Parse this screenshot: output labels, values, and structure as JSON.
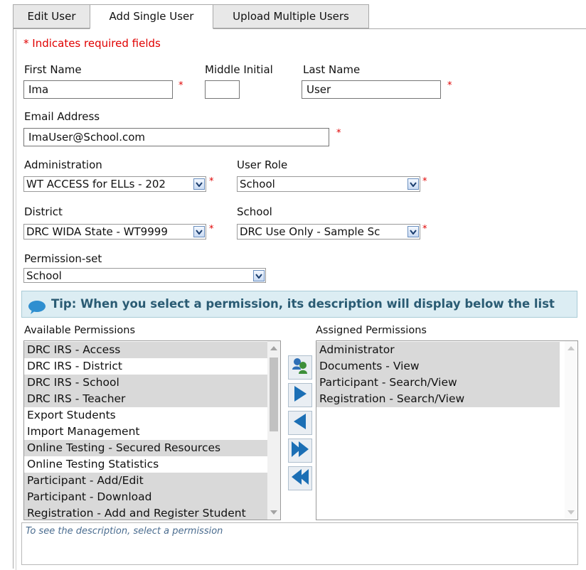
{
  "tabs": [
    {
      "label": "Edit User",
      "active": false
    },
    {
      "label": "Add Single User",
      "active": true
    },
    {
      "label": "Upload Multiple Users",
      "active": false
    }
  ],
  "required_note": "* Indicates required fields",
  "required_mark": "*",
  "fields": {
    "first_name": {
      "label": "First Name",
      "value": "Ima"
    },
    "middle_initial": {
      "label": "Middle Initial",
      "value": ""
    },
    "last_name": {
      "label": "Last Name",
      "value": "User"
    },
    "email": {
      "label": "Email Address",
      "value": "ImaUser@School.com"
    },
    "administration": {
      "label": "Administration",
      "value": "WT ACCESS for ELLs - 202"
    },
    "user_role": {
      "label": "User Role",
      "value": "School"
    },
    "district": {
      "label": "District",
      "value": "DRC WIDA State - WT9999"
    },
    "school": {
      "label": "School",
      "value": "DRC Use Only - Sample Sc"
    },
    "permission_set": {
      "label": "Permission-set",
      "value": "School"
    }
  },
  "tip": "Tip: When you select a permission, its description will display below the list",
  "available": {
    "label": "Available Permissions",
    "items": [
      "DRC IRS - Access",
      "DRC IRS - District",
      "DRC IRS - School",
      "DRC IRS - Teacher",
      "Export Students",
      "Import Management",
      "Online Testing - Secured Resources",
      "Online Testing Statistics",
      "Participant - Add/Edit",
      "Participant - Download",
      "Registration - Add and Register Student"
    ]
  },
  "assigned": {
    "label": "Assigned Permissions",
    "items": [
      "Administrator",
      "Documents - View",
      "Participant - Search/View",
      "Registration - Search/View"
    ]
  },
  "description_placeholder": "To see the description, select a permission",
  "colors": {
    "accent": "#1b6fb5",
    "required": "#e00000",
    "tip_bg": "#dcedf3"
  }
}
